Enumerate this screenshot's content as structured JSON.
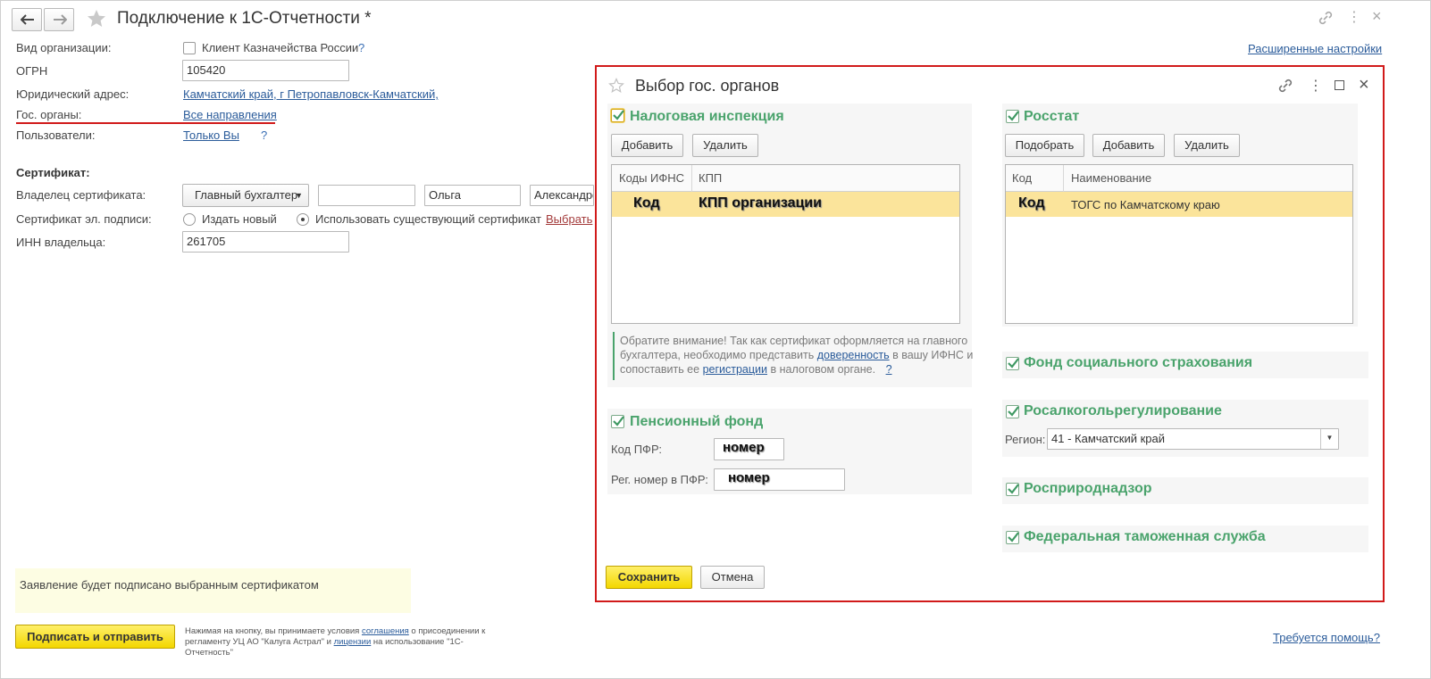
{
  "window": {
    "title": "Подключение к 1С-Отчетности *",
    "advanced_settings_link": "Расширенные настройки"
  },
  "form": {
    "org_type_label": "Вид организации:",
    "treasury_checkbox_label": "Клиент Казначейства России",
    "help_mark": "?",
    "ogrn_label": "ОГРН",
    "ogrn_value": "105420",
    "address_label": "Юридический адрес:",
    "address_value": "Камчатский край, г Петропавловск-Камчатский,",
    "gov_bodies_label": "Гос. органы:",
    "gov_bodies_value": "Все направления",
    "users_label": "Пользователи:",
    "users_value": "Только Вы",
    "certificate_section": "Сертификат:",
    "owner_label": "Владелец сертификата:",
    "owner_select": "Главный бухгалтер",
    "owner_lastname": "",
    "owner_firstname": "Ольга",
    "owner_middlename": "Александро",
    "signature_label": "Сертификат эл. подписи:",
    "radio_new": "Издать новый",
    "radio_existing": "Использовать существующий сертификат",
    "choose_link": "Выбрать",
    "inn_label": "ИНН владельца:",
    "inn_value": "261705",
    "signed_note": "Заявление будет подписано выбранным сертификатом",
    "submit_button": "Подписать и отправить",
    "footer_text_1": "Нажимая на кнопку, вы принимаете условия ",
    "footer_link_1": "соглашения",
    "footer_text_2": " о присоединении к регламенту УЦ АО \"Калуга Астрал\" и ",
    "footer_link_2": "лицензии",
    "footer_text_3": " на использование \"1С-Отчетность\"",
    "help_link": "Требуется помощь?"
  },
  "dialog": {
    "title": "Выбор гос. органов",
    "tax": {
      "header": "Налоговая инспекция",
      "add_button": "Добавить",
      "delete_button": "Удалить",
      "columns": [
        "Коды ИФНС",
        "КПП"
      ],
      "row": [
        "Код",
        "КПП организации"
      ],
      "note_1": "Обратите внимание! Так как сертификат оформляется на главного бухгалтера, необходимо представить ",
      "note_link_1": "доверенность",
      "note_2": " в вашу ИФНС и сопоставить ее ",
      "note_link_2": "регистрации",
      "note_3": " в налоговом органе.",
      "note_help": "?"
    },
    "rosstat": {
      "header": "Росстат",
      "pick_button": "Подобрать",
      "add_button": "Добавить",
      "delete_button": "Удалить",
      "columns": [
        "Код",
        "Наименование"
      ],
      "row": [
        "Код",
        "ТОГС по Камчатскому краю"
      ]
    },
    "fss": {
      "header": "Фонд социального страхования"
    },
    "pension": {
      "header": "Пенсионный фонд",
      "code_label": "Код ПФР:",
      "code_value": "номер",
      "reg_label": "Рег. номер в ПФР:",
      "reg_value": "номер"
    },
    "alcohol": {
      "header": "Росалкогольрегулирование",
      "region_label": "Регион:",
      "region_value": "41 - Камчатский край"
    },
    "nature": {
      "header": "Росприроднадзор"
    },
    "customs": {
      "header": "Федеральная таможенная служба"
    },
    "save_button": "Сохранить",
    "cancel_button": "Отмена"
  },
  "colors": {
    "accent_green": "#4aa36c",
    "highlight_row": "#fbe49b",
    "primary_button": "#f3d700",
    "dialog_border": "#d11a1a",
    "link": "#2a5b9a"
  },
  "icons": [
    "back-arrow-icon",
    "forward-arrow-icon",
    "favorite-star-icon",
    "link-icon",
    "more-icon",
    "close-icon",
    "maximize-icon",
    "checkbox-checked-icon",
    "dropdown-arrow-icon"
  ]
}
